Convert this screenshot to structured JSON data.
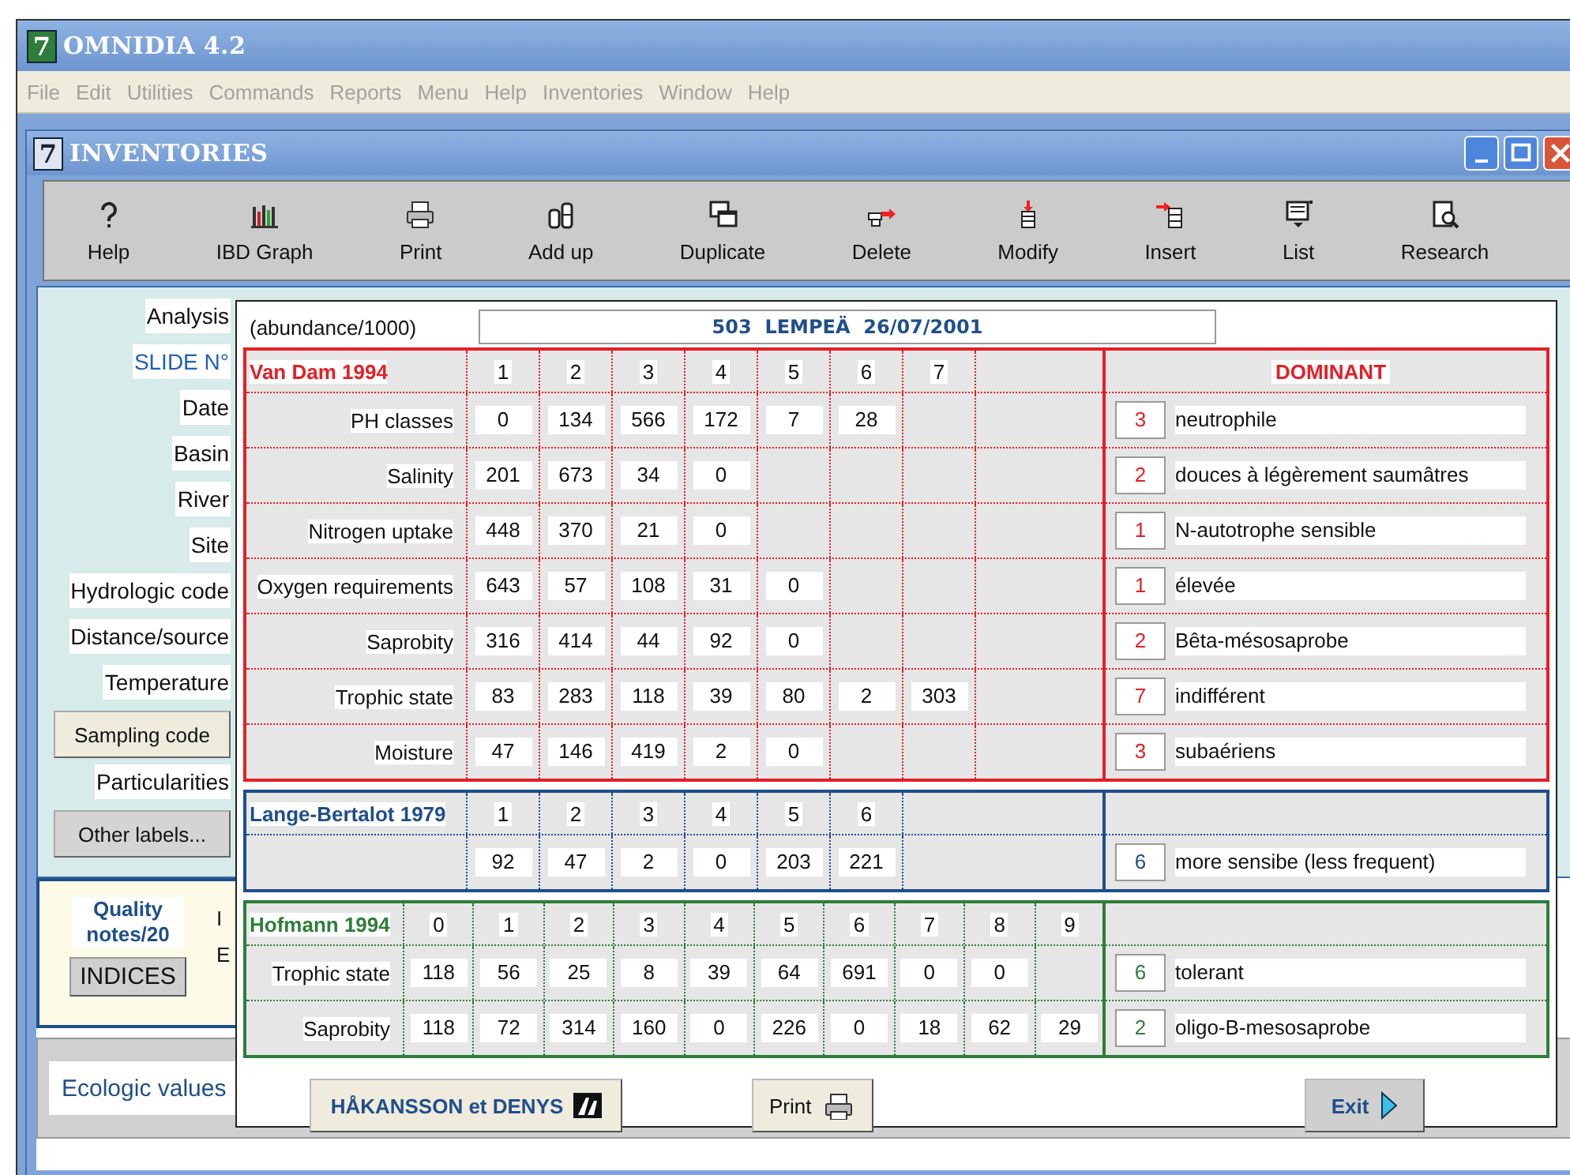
{
  "app": {
    "logo": "7",
    "title": "OMNIDIA 4.2"
  },
  "menu": [
    {
      "label": "File",
      "disabled": true
    },
    {
      "label": "Edit",
      "disabled": true
    },
    {
      "label": "Utilities",
      "disabled": true
    },
    {
      "label": "Commands",
      "disabled": true
    },
    {
      "label": "Reports",
      "disabled": true
    },
    {
      "label": "Menu",
      "disabled": true
    },
    {
      "label": "Help",
      "disabled": true
    },
    {
      "label": "Inventories",
      "disabled": true
    },
    {
      "label": "Window",
      "disabled": true
    },
    {
      "label": "Help",
      "disabled": true
    }
  ],
  "window": {
    "logo": "7",
    "title": "INVENTORIES"
  },
  "toolbar": [
    {
      "label": "Help"
    },
    {
      "label": "IBD Graph"
    },
    {
      "label": "Print"
    },
    {
      "label": "Add up"
    },
    {
      "label": "Duplicate"
    },
    {
      "label": "Delete"
    },
    {
      "label": "Modify"
    },
    {
      "label": "Insert"
    },
    {
      "label": "List"
    },
    {
      "label": "Research"
    }
  ],
  "form": [
    {
      "kind": "label",
      "text": "Analysis"
    },
    {
      "kind": "link",
      "text": "SLIDE N°"
    },
    {
      "kind": "label",
      "text": "Date"
    },
    {
      "kind": "label",
      "text": "Basin"
    },
    {
      "kind": "label",
      "text": "River"
    },
    {
      "kind": "label",
      "text": "Site"
    },
    {
      "kind": "label",
      "text": "Hydrologic code"
    },
    {
      "kind": "label",
      "text": "Distance/source"
    },
    {
      "kind": "label",
      "text": "Temperature"
    },
    {
      "kind": "button",
      "text": "Sampling code"
    },
    {
      "kind": "label",
      "text": "Particularities"
    },
    {
      "kind": "button",
      "text": "Other labels..."
    }
  ],
  "quality": {
    "title": "Quality notes/20",
    "button": "INDICES",
    "side_labels": [
      "I",
      "E"
    ]
  },
  "ecologic": {
    "label": "Ecologic values"
  },
  "popup": {
    "unit": "(abundance/1000)",
    "heading": "503  LEMPEÄ  26/07/2001",
    "sections": [
      {
        "title": "Van Dam 1994",
        "color": "#e41f26",
        "dominant_title": "DOMINANT",
        "columns": [
          "1",
          "2",
          "3",
          "4",
          "5",
          "6",
          "7"
        ],
        "rows": [
          {
            "label": "PH classes",
            "values": [
              "0",
              "134",
              "566",
              "172",
              "7",
              "28"
            ],
            "dominant": {
              "code": "3",
              "text": "neutrophile"
            }
          },
          {
            "label": "Salinity",
            "values": [
              "201",
              "673",
              "34",
              "0"
            ],
            "dominant": {
              "code": "2",
              "text": "douces à légèrement saumâtres"
            }
          },
          {
            "label": "Nitrogen uptake",
            "values": [
              "448",
              "370",
              "21",
              "0"
            ],
            "dominant": {
              "code": "1",
              "text": "N-autotrophe sensible"
            }
          },
          {
            "label": "Oxygen requirements",
            "values": [
              "643",
              "57",
              "108",
              "31",
              "0"
            ],
            "dominant": {
              "code": "1",
              "text": "élevée"
            }
          },
          {
            "label": "Saprobity",
            "values": [
              "316",
              "414",
              "44",
              "92",
              "0"
            ],
            "dominant": {
              "code": "2",
              "text": "Bêta-mésosaprobe"
            }
          },
          {
            "label": "Trophic state",
            "values": [
              "83",
              "283",
              "118",
              "39",
              "80",
              "2",
              "303"
            ],
            "dominant": {
              "code": "7",
              "text": "indifférent"
            }
          },
          {
            "label": "Moisture",
            "values": [
              "47",
              "146",
              "419",
              "2",
              "0"
            ],
            "dominant": {
              "code": "3",
              "text": "subaériens"
            }
          }
        ]
      },
      {
        "title": "Lange-Bertalot 1979",
        "color": "#1f4e8c",
        "columns": [
          "1",
          "2",
          "3",
          "4",
          "5",
          "6"
        ],
        "rows": [
          {
            "values": [
              "92",
              "47",
              "2",
              "0",
              "203",
              "221"
            ],
            "dominant": {
              "code": "6",
              "text": "more sensibe (less frequent)"
            }
          }
        ]
      },
      {
        "title": "Hofmann 1994",
        "color": "#2e7d3a",
        "columns": [
          "0",
          "1",
          "2",
          "3",
          "4",
          "5",
          "6",
          "7",
          "8",
          "9"
        ],
        "rows": [
          {
            "label": "Trophic state",
            "values": [
              "118",
              "56",
              "25",
              "8",
              "39",
              "64",
              "691",
              "0",
              "0"
            ],
            "dominant": {
              "code": "6",
              "text": "tolerant"
            }
          },
          {
            "label": "Saprobity",
            "values": [
              "118",
              "72",
              "314",
              "160",
              "0",
              "226",
              "0",
              "18",
              "62",
              "29"
            ],
            "dominant": {
              "code": "2",
              "text": "oligo-B-mesosaprobe"
            }
          }
        ]
      }
    ],
    "buttons": [
      {
        "kind": "logo",
        "label": "HÅKANSSON et DENYS"
      },
      {
        "kind": "print",
        "label": "Print"
      },
      {
        "kind": "exit",
        "label": "Exit"
      }
    ]
  }
}
